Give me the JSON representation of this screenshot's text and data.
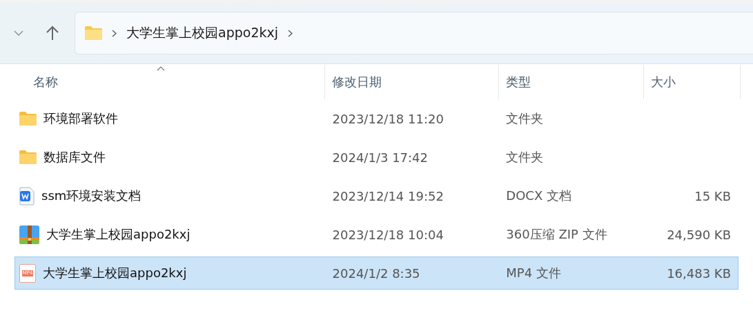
{
  "toolbar": {
    "breadcrumb": [
      {
        "label": "大学生掌上校园appo2kxj"
      }
    ]
  },
  "table": {
    "columns": [
      {
        "label": "名称",
        "sorted_ascending": true
      },
      {
        "label": "修改日期"
      },
      {
        "label": "类型"
      },
      {
        "label": "大小"
      }
    ],
    "rows": [
      {
        "kind": "folder",
        "name": "环境部署软件",
        "modified": "2023/12/18 11:20",
        "type": "文件夹",
        "selected": false
      },
      {
        "kind": "folder",
        "name": "数据库文件",
        "modified": "2024/1/3 17:42",
        "type": "文件夹",
        "selected": false
      },
      {
        "kind": "docx",
        "name": "ssm环境安装文档",
        "modified": "2023/12/14 19:52",
        "type": "DOCX 文档",
        "size": "15 KB",
        "selected": false
      },
      {
        "kind": "zip",
        "name": "大学生掌上校园appo2kxj",
        "modified": "2023/12/18 10:04",
        "type": "360压缩 ZIP 文件",
        "size": "24,590 KB",
        "selected": false
      },
      {
        "kind": "mp4",
        "icon_label": "MP4",
        "name": "大学生掌上校园appo2kxj",
        "modified": "2024/1/2 8:35",
        "type": "MP4 文件",
        "size": "16,483 KB",
        "selected": true
      }
    ]
  }
}
